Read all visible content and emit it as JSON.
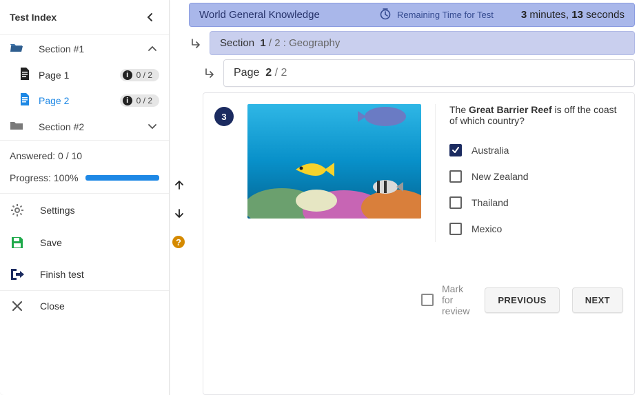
{
  "sidebar": {
    "title": "Test Index",
    "sections": [
      {
        "label": "Section #1",
        "expanded": true,
        "pages": [
          {
            "label": "Page 1",
            "score": "0 / 2",
            "active": false
          },
          {
            "label": "Page 2",
            "score": "0 / 2",
            "active": true
          }
        ]
      },
      {
        "label": "Section #2",
        "expanded": false
      }
    ],
    "answered_label": "Answered: 0 / 10",
    "progress_label": "Progress: 100%",
    "actions": {
      "settings": "Settings",
      "save": "Save",
      "finish": "Finish test",
      "close": "Close"
    }
  },
  "header": {
    "test_title": "World General Knowledge",
    "remaining_label": "Remaining Time for Test",
    "time_minutes": "3",
    "time_min_word": " minutes, ",
    "time_seconds": "13",
    "time_sec_word": " seconds"
  },
  "section_bar": {
    "prefix": "Section",
    "current": "1",
    "sep": "/ 2",
    "name": ": Geography"
  },
  "page_bar": {
    "prefix": "Page",
    "current": "2",
    "sep": "/ 2"
  },
  "question": {
    "number": "3",
    "text_pre": "The ",
    "text_bold": "Great Barrier Reef",
    "text_post": " is off the coast of which country?",
    "options": [
      {
        "label": "Australia",
        "checked": true
      },
      {
        "label": "New Zealand",
        "checked": false
      },
      {
        "label": "Thailand",
        "checked": false
      },
      {
        "label": "Mexico",
        "checked": false
      }
    ]
  },
  "footer": {
    "mark_label": "Mark for review",
    "prev": "PREVIOUS",
    "next": "NEXT"
  }
}
